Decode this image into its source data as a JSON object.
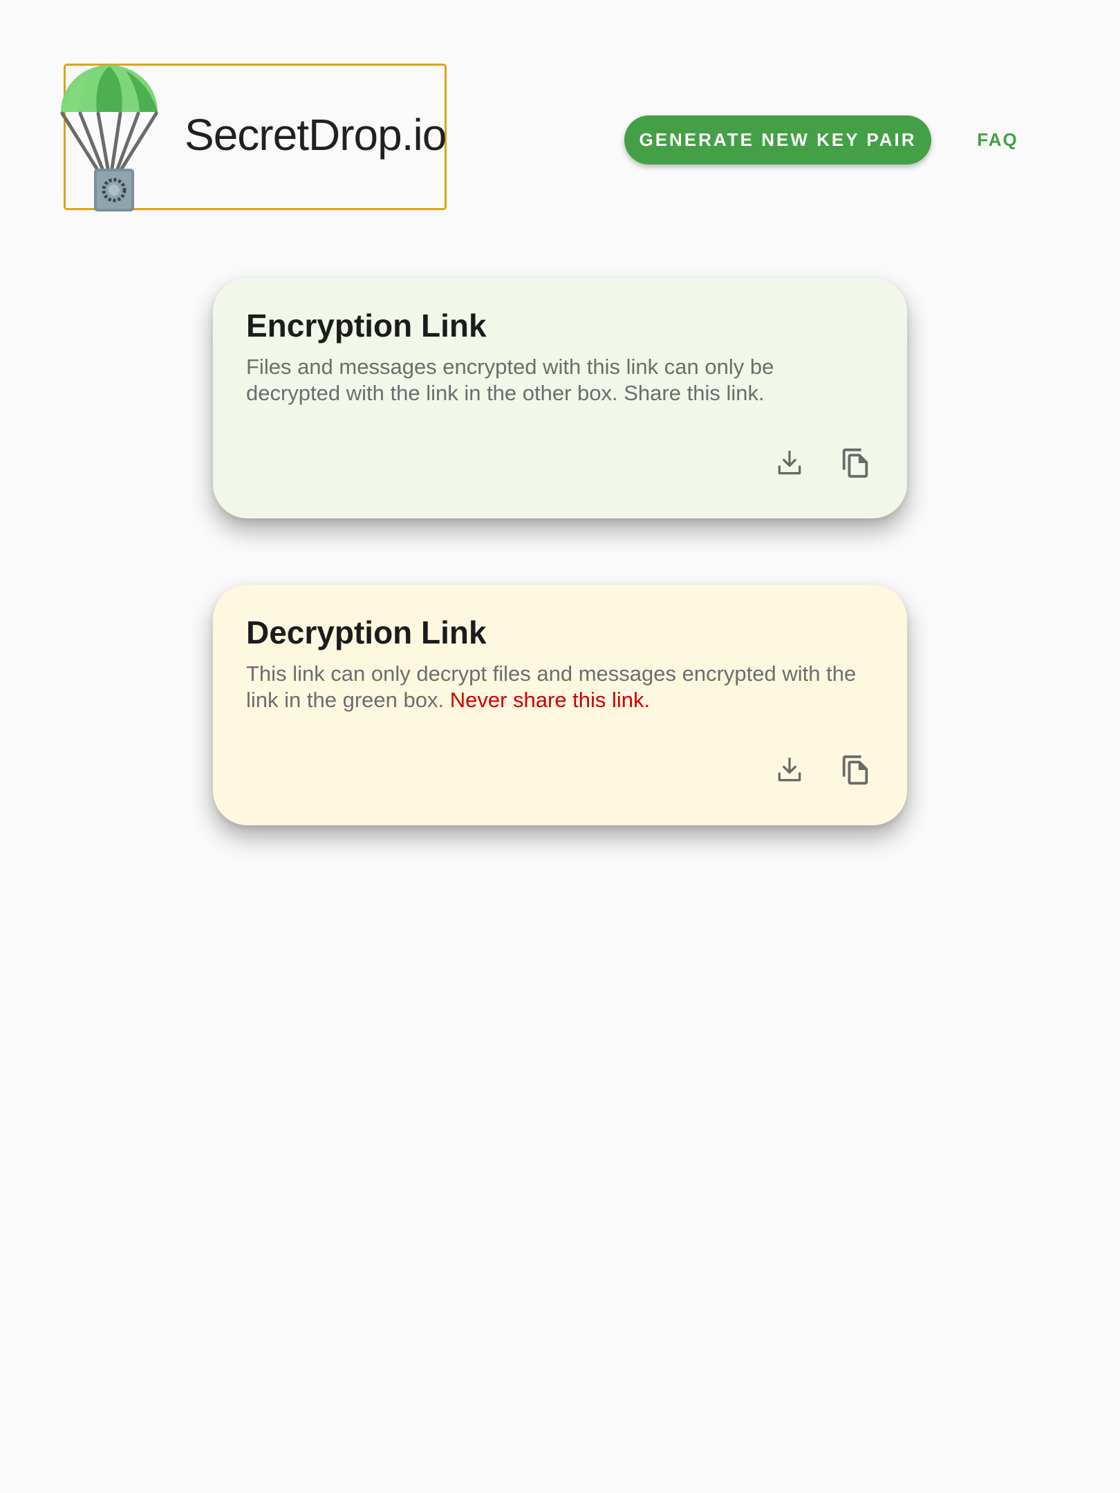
{
  "header": {
    "logo_text": "SecretDrop.io",
    "generate_button_label": "GENERATE NEW KEY PAIR",
    "faq_label": "FAQ"
  },
  "encryption_card": {
    "title": "Encryption Link",
    "description": "Files and messages encrypted with this link can only be decrypted with the link in the other box. Share this link.",
    "download_icon": "download-icon",
    "copy_icon": "copy-icon"
  },
  "decryption_card": {
    "title": "Decryption Link",
    "description": "This link can only decrypt files and messages encrypted with the link in the green box.",
    "warning": "Never share this link.",
    "download_icon": "download-icon",
    "copy_icon": "copy-icon"
  },
  "colors": {
    "accent_green": "#43a047",
    "encryption_card_bg": "#f1f8e9",
    "decryption_card_bg": "#fff8e1",
    "warning_red": "#cc0000",
    "logo_border": "#e0a21a"
  }
}
